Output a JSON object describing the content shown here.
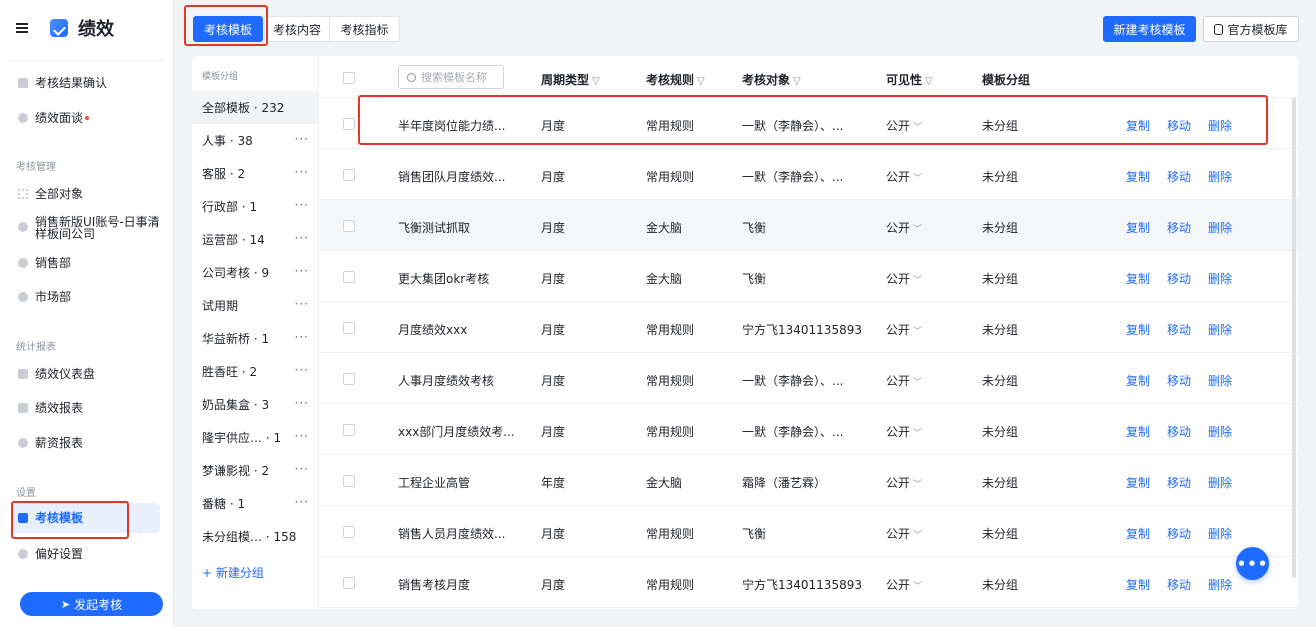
{
  "app": {
    "title": "绩效"
  },
  "sidebar": {
    "items": [
      {
        "label": "考核结果确认"
      },
      {
        "label": "绩效面谈"
      }
    ],
    "sections": [
      {
        "title": "考核管理",
        "items": [
          {
            "label": "全部对象"
          },
          {
            "label": "销售新版UI账号-日事清"
          },
          {
            "label": "样板间公司"
          },
          {
            "label": "销售部"
          },
          {
            "label": "市场部"
          }
        ]
      },
      {
        "title": "统计报表",
        "items": [
          {
            "label": "绩效仪表盘"
          },
          {
            "label": "绩效报表"
          },
          {
            "label": "薪资报表"
          }
        ]
      },
      {
        "title": "设置",
        "items": [
          {
            "label": "考核模板"
          },
          {
            "label": "偏好设置"
          }
        ]
      }
    ],
    "launch_button": "发起考核"
  },
  "tabs": [
    {
      "label": "考核模板"
    },
    {
      "label": "考核内容"
    },
    {
      "label": "考核指标"
    }
  ],
  "toolbar": {
    "new_template": "新建考核模板",
    "official_library": "官方模板库"
  },
  "groups": {
    "header": "模板分组",
    "items": [
      {
        "label": "全部模板 · 232"
      },
      {
        "label": "人事 · 38"
      },
      {
        "label": "客服 · 2"
      },
      {
        "label": "行政部 · 1"
      },
      {
        "label": "运营部 · 14"
      },
      {
        "label": "公司考核 · 9"
      },
      {
        "label": "试用期"
      },
      {
        "label": "华益新桥 · 1"
      },
      {
        "label": "胜香旺 · 2"
      },
      {
        "label": "奶品集盒 · 3"
      },
      {
        "label": "隆宇供应…  · 1"
      },
      {
        "label": "梦谦影视 · 2"
      },
      {
        "label": "番糖 · 1"
      },
      {
        "label": "未分组模…  · 158"
      }
    ],
    "more": "···",
    "new_group": "+ 新建分组"
  },
  "table": {
    "search_placeholder": "搜索模板名称",
    "columns": {
      "period": "周期类型",
      "rule": "考核规则",
      "target": "考核对象",
      "visibility": "可见性",
      "group": "模板分组"
    },
    "filter_icon": "▽",
    "caret": "﹀",
    "actions": {
      "copy": "复制",
      "move": "移动",
      "delete": "删除"
    },
    "rows": [
      {
        "name": "半年度岗位能力绩...",
        "period": "月度",
        "rule": "常用规则",
        "target": "一默（李静会）、...",
        "visibility": "公开",
        "group": "未分组"
      },
      {
        "name": "销售团队月度绩效...",
        "period": "月度",
        "rule": "常用规则",
        "target": "一默（李静会）、...",
        "visibility": "公开",
        "group": "未分组"
      },
      {
        "name": "飞衡测试抓取",
        "period": "月度",
        "rule": "金大脑",
        "target": "飞衡",
        "visibility": "公开",
        "group": "未分组"
      },
      {
        "name": "更大集团okr考核",
        "period": "月度",
        "rule": "金大脑",
        "target": "飞衡",
        "visibility": "公开",
        "group": "未分组"
      },
      {
        "name": "月度绩效xxx",
        "period": "月度",
        "rule": "常用规则",
        "target": "宁方飞13401135893",
        "visibility": "公开",
        "group": "未分组"
      },
      {
        "name": "人事月度绩效考核",
        "period": "月度",
        "rule": "常用规则",
        "target": "一默（李静会）、...",
        "visibility": "公开",
        "group": "未分组"
      },
      {
        "name": "xxx部门月度绩效考...",
        "period": "月度",
        "rule": "常用规则",
        "target": "一默（李静会）、...",
        "visibility": "公开",
        "group": "未分组"
      },
      {
        "name": "工程企业高管",
        "period": "年度",
        "rule": "金大脑",
        "target": "霜降（潘艺霖）",
        "visibility": "公开",
        "group": "未分组"
      },
      {
        "name": "销售人员月度绩效...",
        "period": "月度",
        "rule": "常用规则",
        "target": "飞衡",
        "visibility": "公开",
        "group": "未分组"
      },
      {
        "name": "销售考核月度",
        "period": "月度",
        "rule": "常用规则",
        "target": "宁方飞13401135893",
        "visibility": "公开",
        "group": "未分组"
      }
    ]
  },
  "fab": {
    "label": "•••"
  },
  "colors": {
    "accent": "#1f6bff",
    "highlight_box": "#e0392a",
    "notify_dot": "#f54a45"
  }
}
